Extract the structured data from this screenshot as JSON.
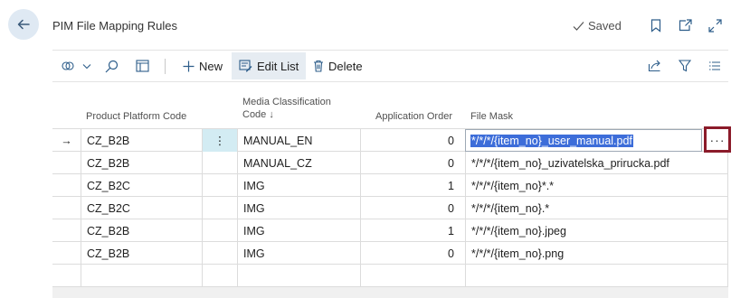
{
  "header": {
    "title": "PIM File Mapping Rules",
    "status": "Saved"
  },
  "toolbar": {
    "new_label": "New",
    "edit_list_label": "Edit List",
    "delete_label": "Delete"
  },
  "columns": {
    "product_platform_code": "Product Platform Code",
    "media_classification_code_line1": "Media Classification",
    "media_classification_code_line2": "Code ↓",
    "application_order": "Application Order",
    "file_mask": "File Mask"
  },
  "rows": [
    {
      "platform": "CZ_B2B",
      "media": "MANUAL_EN",
      "order": "0",
      "mask": "*/*/*/{item_no}_user_manual.pdf",
      "current": true
    },
    {
      "platform": "CZ_B2B",
      "media": "MANUAL_CZ",
      "order": "0",
      "mask": "*/*/*/{item_no}_uzivatelska_prirucka.pdf"
    },
    {
      "platform": "CZ_B2C",
      "media": "IMG",
      "order": "1",
      "mask": "*/*/*/{item_no}*.*"
    },
    {
      "platform": "CZ_B2C",
      "media": "IMG",
      "order": "0",
      "mask": "*/*/*/{item_no}.*"
    },
    {
      "platform": "CZ_B2B",
      "media": "IMG",
      "order": "1",
      "mask": "*/*/*/{item_no}.jpeg"
    },
    {
      "platform": "CZ_B2B",
      "media": "IMG",
      "order": "0",
      "mask": "*/*/*/{item_no}.png"
    }
  ],
  "lookup_label": "···",
  "row_menu_label": "⋮",
  "current_row_indicator": "→",
  "colors": {
    "accent": "#3d6dd9",
    "highlight_border": "#8b1b2a",
    "back_button_bg": "#dfe9f3"
  },
  "icons": {
    "back": "arrow-left-icon",
    "saved_check": "check-icon",
    "bookmark": "bookmark-icon",
    "open_new": "open-in-new-window-icon",
    "expand": "expand-icon",
    "filter_pane": "filter-pane-icon",
    "search": "search-icon",
    "view_layout": "layout-icon",
    "share": "share-icon",
    "filter": "filter-icon",
    "list": "list-icon"
  }
}
